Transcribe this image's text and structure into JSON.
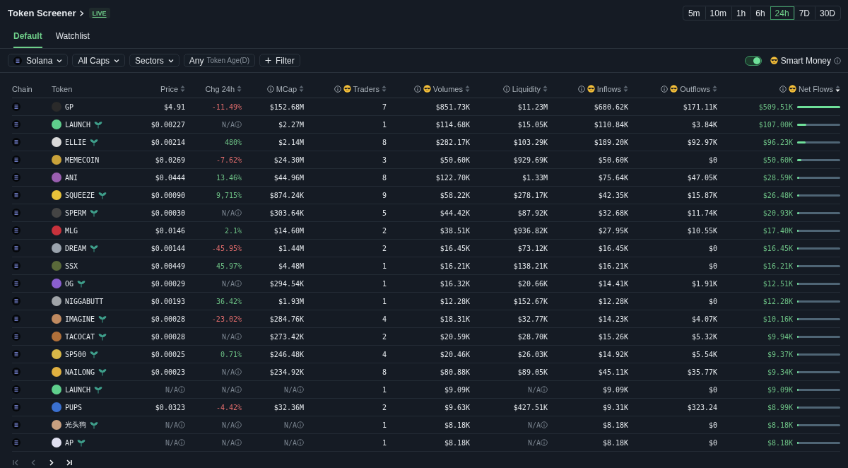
{
  "header": {
    "title": "Token Screener",
    "badge": "LIVE"
  },
  "time_ranges": [
    {
      "label": "5m",
      "selected": false
    },
    {
      "label": "10m",
      "selected": false
    },
    {
      "label": "1h",
      "selected": false
    },
    {
      "label": "6h",
      "selected": false
    },
    {
      "label": "24h",
      "selected": true
    },
    {
      "label": "7D",
      "selected": false
    },
    {
      "label": "30D",
      "selected": false
    }
  ],
  "tabs": [
    {
      "label": "Default",
      "selected": true
    },
    {
      "label": "Watchlist",
      "selected": false
    }
  ],
  "filters": [
    {
      "kind": "chain",
      "label": "Solana"
    },
    {
      "kind": "dropdown",
      "label": "All Caps"
    },
    {
      "kind": "dropdown",
      "label": "Sectors"
    },
    {
      "kind": "age",
      "label": "Any",
      "hint": "Token Age(D)"
    },
    {
      "kind": "add",
      "label": "Filter"
    }
  ],
  "smart_money": {
    "label": "Smart Money",
    "on": true
  },
  "table": {
    "columns": [
      {
        "label": "Chain"
      },
      {
        "label": "Token"
      },
      {
        "label": "Price",
        "sortable": true
      },
      {
        "label": "Chg 24h",
        "sortable": true
      },
      {
        "label": "MCap",
        "info": true,
        "sortable": true
      },
      {
        "label": "Traders",
        "info": true,
        "smart": true,
        "sortable": true
      },
      {
        "label": "Volumes",
        "info": true,
        "smart": true,
        "sortable": true
      },
      {
        "label": "Liquidity",
        "info": true,
        "sortable": true
      },
      {
        "label": "Inflows",
        "info": true,
        "smart": true,
        "sortable": true
      },
      {
        "label": "Outflows",
        "info": true,
        "smart": true,
        "sortable": true
      },
      {
        "label": "Net Flows",
        "info": true,
        "smart": true,
        "sortable": true,
        "sorted": true
      }
    ],
    "rows": [
      {
        "token": "GP",
        "price": "$4.91",
        "change": {
          "text": "-11.49%",
          "kind": "down"
        },
        "mcap": "$152.68M",
        "traders": "7",
        "volumes": "$851.73K",
        "liquidity": "$11.23M",
        "inflows": "$680.62K",
        "outflows": "$171.11K",
        "net_flows": "$509.51K",
        "level": 1.0
      },
      {
        "token": "LAUNCH",
        "new": true,
        "price": "$0.00227",
        "change": {
          "text": "N/A",
          "kind": "na",
          "info": true
        },
        "mcap": "$2.27M",
        "traders": "1",
        "volumes": "$114.68K",
        "liquidity": "$15.05K",
        "inflows": "$110.84K",
        "outflows": "$3.84K",
        "net_flows": "$107.00K",
        "level": 0.21
      },
      {
        "token": "ELLIE",
        "new": true,
        "price": "$0.00214",
        "change": {
          "text": "480%",
          "kind": "up"
        },
        "mcap": "$2.14M",
        "traders": "8",
        "volumes": "$282.17K",
        "liquidity": "$103.29K",
        "inflows": "$189.20K",
        "outflows": "$92.97K",
        "net_flows": "$96.23K",
        "level": 0.19
      },
      {
        "token": "MEMECOIN",
        "price": "$0.0269",
        "change": {
          "text": "-7.62%",
          "kind": "down"
        },
        "mcap": "$24.30M",
        "traders": "3",
        "volumes": "$50.60K",
        "liquidity": "$929.69K",
        "inflows": "$50.60K",
        "outflows": "$0",
        "net_flows": "$50.60K",
        "level": 0.1
      },
      {
        "token": "ANI",
        "price": "$0.0444",
        "change": {
          "text": "13.46%",
          "kind": "up"
        },
        "mcap": "$44.96M",
        "traders": "8",
        "volumes": "$122.70K",
        "liquidity": "$1.33M",
        "inflows": "$75.64K",
        "outflows": "$47.05K",
        "net_flows": "$28.59K",
        "level": 0.056
      },
      {
        "token": "SQUEEZE",
        "new": true,
        "price": "$0.00090",
        "change": {
          "text": "9,715%",
          "kind": "up"
        },
        "mcap": "$874.24K",
        "traders": "9",
        "volumes": "$58.22K",
        "liquidity": "$278.17K",
        "inflows": "$42.35K",
        "outflows": "$15.87K",
        "net_flows": "$26.48K",
        "level": 0.052
      },
      {
        "token": "SPERM",
        "new": true,
        "price": "$0.00030",
        "change": {
          "text": "N/A",
          "kind": "na",
          "info": true
        },
        "mcap": "$303.64K",
        "traders": "5",
        "volumes": "$44.42K",
        "liquidity": "$87.92K",
        "inflows": "$32.68K",
        "outflows": "$11.74K",
        "net_flows": "$20.93K",
        "level": 0.041
      },
      {
        "token": "MLG",
        "price": "$0.0146",
        "change": {
          "text": "2.1%",
          "kind": "up"
        },
        "mcap": "$14.60M",
        "traders": "2",
        "volumes": "$38.51K",
        "liquidity": "$936.82K",
        "inflows": "$27.95K",
        "outflows": "$10.55K",
        "net_flows": "$17.40K",
        "level": 0.034
      },
      {
        "token": "DREAM",
        "new": true,
        "price": "$0.00144",
        "change": {
          "text": "-45.95%",
          "kind": "down"
        },
        "mcap": "$1.44M",
        "traders": "2",
        "volumes": "$16.45K",
        "liquidity": "$73.12K",
        "inflows": "$16.45K",
        "outflows": "$0",
        "net_flows": "$16.45K",
        "level": 0.032
      },
      {
        "token": "SSX",
        "price": "$0.00449",
        "change": {
          "text": "45.97%",
          "kind": "up"
        },
        "mcap": "$4.48M",
        "traders": "1",
        "volumes": "$16.21K",
        "liquidity": "$138.21K",
        "inflows": "$16.21K",
        "outflows": "$0",
        "net_flows": "$16.21K",
        "level": 0.032
      },
      {
        "token": "OG",
        "new": true,
        "price": "$0.00029",
        "change": {
          "text": "N/A",
          "kind": "na",
          "info": true
        },
        "mcap": "$294.54K",
        "traders": "1",
        "volumes": "$16.32K",
        "liquidity": "$20.66K",
        "inflows": "$14.41K",
        "outflows": "$1.91K",
        "net_flows": "$12.51K",
        "level": 0.025
      },
      {
        "token": "NIGGABUTT",
        "price": "$0.00193",
        "change": {
          "text": "36.42%",
          "kind": "up"
        },
        "mcap": "$1.93M",
        "traders": "1",
        "volumes": "$12.28K",
        "liquidity": "$152.67K",
        "inflows": "$12.28K",
        "outflows": "$0",
        "net_flows": "$12.28K",
        "level": 0.024
      },
      {
        "token": "IMAGINE",
        "new": true,
        "price": "$0.00028",
        "change": {
          "text": "-23.02%",
          "kind": "down"
        },
        "mcap": "$284.76K",
        "traders": "4",
        "volumes": "$18.31K",
        "liquidity": "$32.77K",
        "inflows": "$14.23K",
        "outflows": "$4.07K",
        "net_flows": "$10.16K",
        "level": 0.02
      },
      {
        "token": "TACOCAT",
        "new": true,
        "price": "$0.00028",
        "change": {
          "text": "N/A",
          "kind": "na",
          "info": true
        },
        "mcap": "$273.42K",
        "traders": "2",
        "volumes": "$20.59K",
        "liquidity": "$28.70K",
        "inflows": "$15.26K",
        "outflows": "$5.32K",
        "net_flows": "$9.94K",
        "level": 0.02
      },
      {
        "token": "SP500",
        "new": true,
        "price": "$0.00025",
        "change": {
          "text": "0.71%",
          "kind": "up"
        },
        "mcap": "$246.48K",
        "traders": "4",
        "volumes": "$20.46K",
        "liquidity": "$26.03K",
        "inflows": "$14.92K",
        "outflows": "$5.54K",
        "net_flows": "$9.37K",
        "level": 0.018
      },
      {
        "token": "NAILONG",
        "new": true,
        "price": "$0.00023",
        "change": {
          "text": "N/A",
          "kind": "na",
          "info": true
        },
        "mcap": "$234.92K",
        "traders": "8",
        "volumes": "$80.88K",
        "liquidity": "$89.05K",
        "inflows": "$45.11K",
        "outflows": "$35.77K",
        "net_flows": "$9.34K",
        "level": 0.018
      },
      {
        "token": "LAUNCH",
        "new": true,
        "price": {
          "text": "N/A",
          "info": true
        },
        "change": {
          "text": "N/A",
          "kind": "na",
          "info": true
        },
        "mcap": {
          "text": "N/A",
          "info": true
        },
        "traders": "1",
        "volumes": "$9.09K",
        "liquidity": {
          "text": "N/A",
          "info": true
        },
        "inflows": "$9.09K",
        "outflows": "$0",
        "net_flows": "$9.09K",
        "level": 0.018
      },
      {
        "token": "PUPS",
        "price": "$0.0323",
        "change": {
          "text": "-4.42%",
          "kind": "down"
        },
        "mcap": "$32.36M",
        "traders": "2",
        "volumes": "$9.63K",
        "liquidity": "$427.51K",
        "inflows": "$9.31K",
        "outflows": "$323.24",
        "net_flows": "$8.99K",
        "level": 0.018
      },
      {
        "token": "光头狗",
        "new": true,
        "price": {
          "text": "N/A",
          "info": true
        },
        "change": {
          "text": "N/A",
          "kind": "na",
          "info": true
        },
        "mcap": {
          "text": "N/A",
          "info": true
        },
        "traders": "1",
        "volumes": "$8.18K",
        "liquidity": {
          "text": "N/A",
          "info": true
        },
        "inflows": "$8.18K",
        "outflows": "$0",
        "net_flows": "$8.18K",
        "level": 0.016
      },
      {
        "token": "AP",
        "new": true,
        "price": {
          "text": "N/A",
          "info": true
        },
        "change": {
          "text": "N/A",
          "kind": "na",
          "info": true
        },
        "mcap": {
          "text": "N/A",
          "info": true
        },
        "traders": "1",
        "volumes": "$8.18K",
        "liquidity": {
          "text": "N/A",
          "info": true
        },
        "inflows": "$8.18K",
        "outflows": "$0",
        "net_flows": "$8.18K",
        "level": 0.016
      }
    ]
  },
  "pagination": [
    {
      "kind": "first",
      "disabled": true
    },
    {
      "kind": "prev",
      "disabled": true
    },
    {
      "kind": "next",
      "disabled": false
    },
    {
      "kind": "last",
      "disabled": false
    }
  ]
}
